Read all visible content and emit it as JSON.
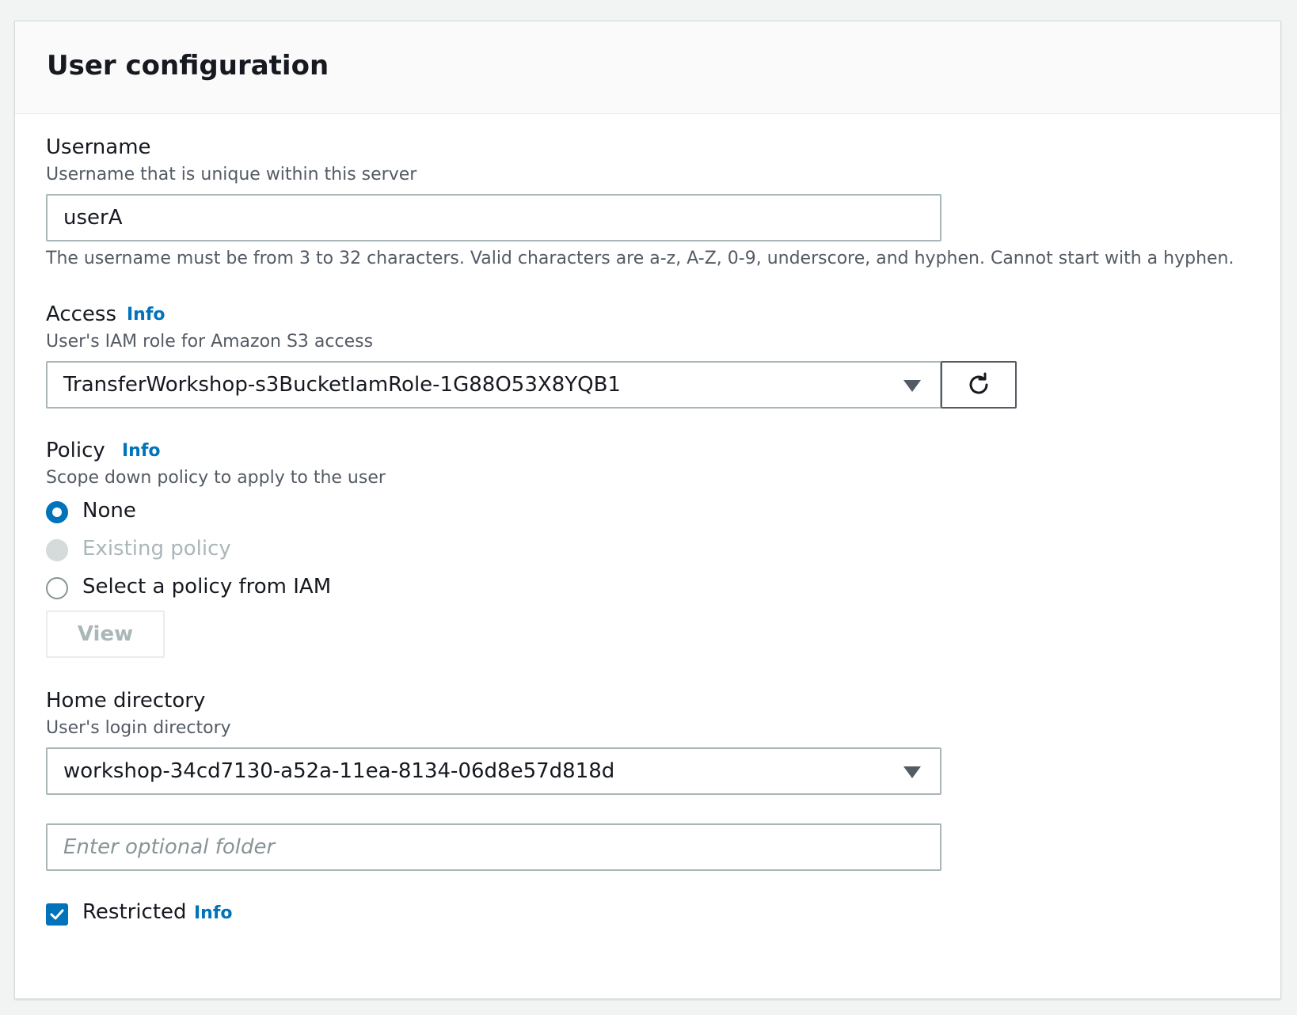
{
  "panel": {
    "title": "User configuration"
  },
  "username": {
    "label": "Username",
    "description": "Username that is unique within this server",
    "value": "userA",
    "constraint": "The username must be from 3 to 32 characters. Valid characters are a-z, A-Z, 0-9, underscore, and hyphen. Cannot start with a hyphen."
  },
  "access": {
    "label": "Access",
    "info": "Info",
    "description": "User's IAM role for Amazon S3 access",
    "selected": "TransferWorkshop-s3BucketIamRole-1G88O53X8YQB1",
    "refresh_icon": "refresh-icon"
  },
  "policy": {
    "label": "Policy",
    "info": "Info",
    "description": "Scope down policy to apply to the user",
    "options": [
      {
        "label": "None",
        "state": "checked"
      },
      {
        "label": "Existing policy",
        "state": "disabled"
      },
      {
        "label": "Select a policy from IAM",
        "state": "unchecked"
      }
    ],
    "view_button": "View"
  },
  "home_directory": {
    "label": "Home directory",
    "description": "User's login directory",
    "selected": "workshop-34cd7130-a52a-11ea-8134-06d8e57d818d",
    "folder_placeholder": "Enter optional folder"
  },
  "restricted": {
    "label": "Restricted",
    "info": "Info",
    "checked": true
  },
  "colors": {
    "accent": "#0073bb",
    "text": "#16191f",
    "muted": "#545b64",
    "disabled": "#aab7b8"
  }
}
